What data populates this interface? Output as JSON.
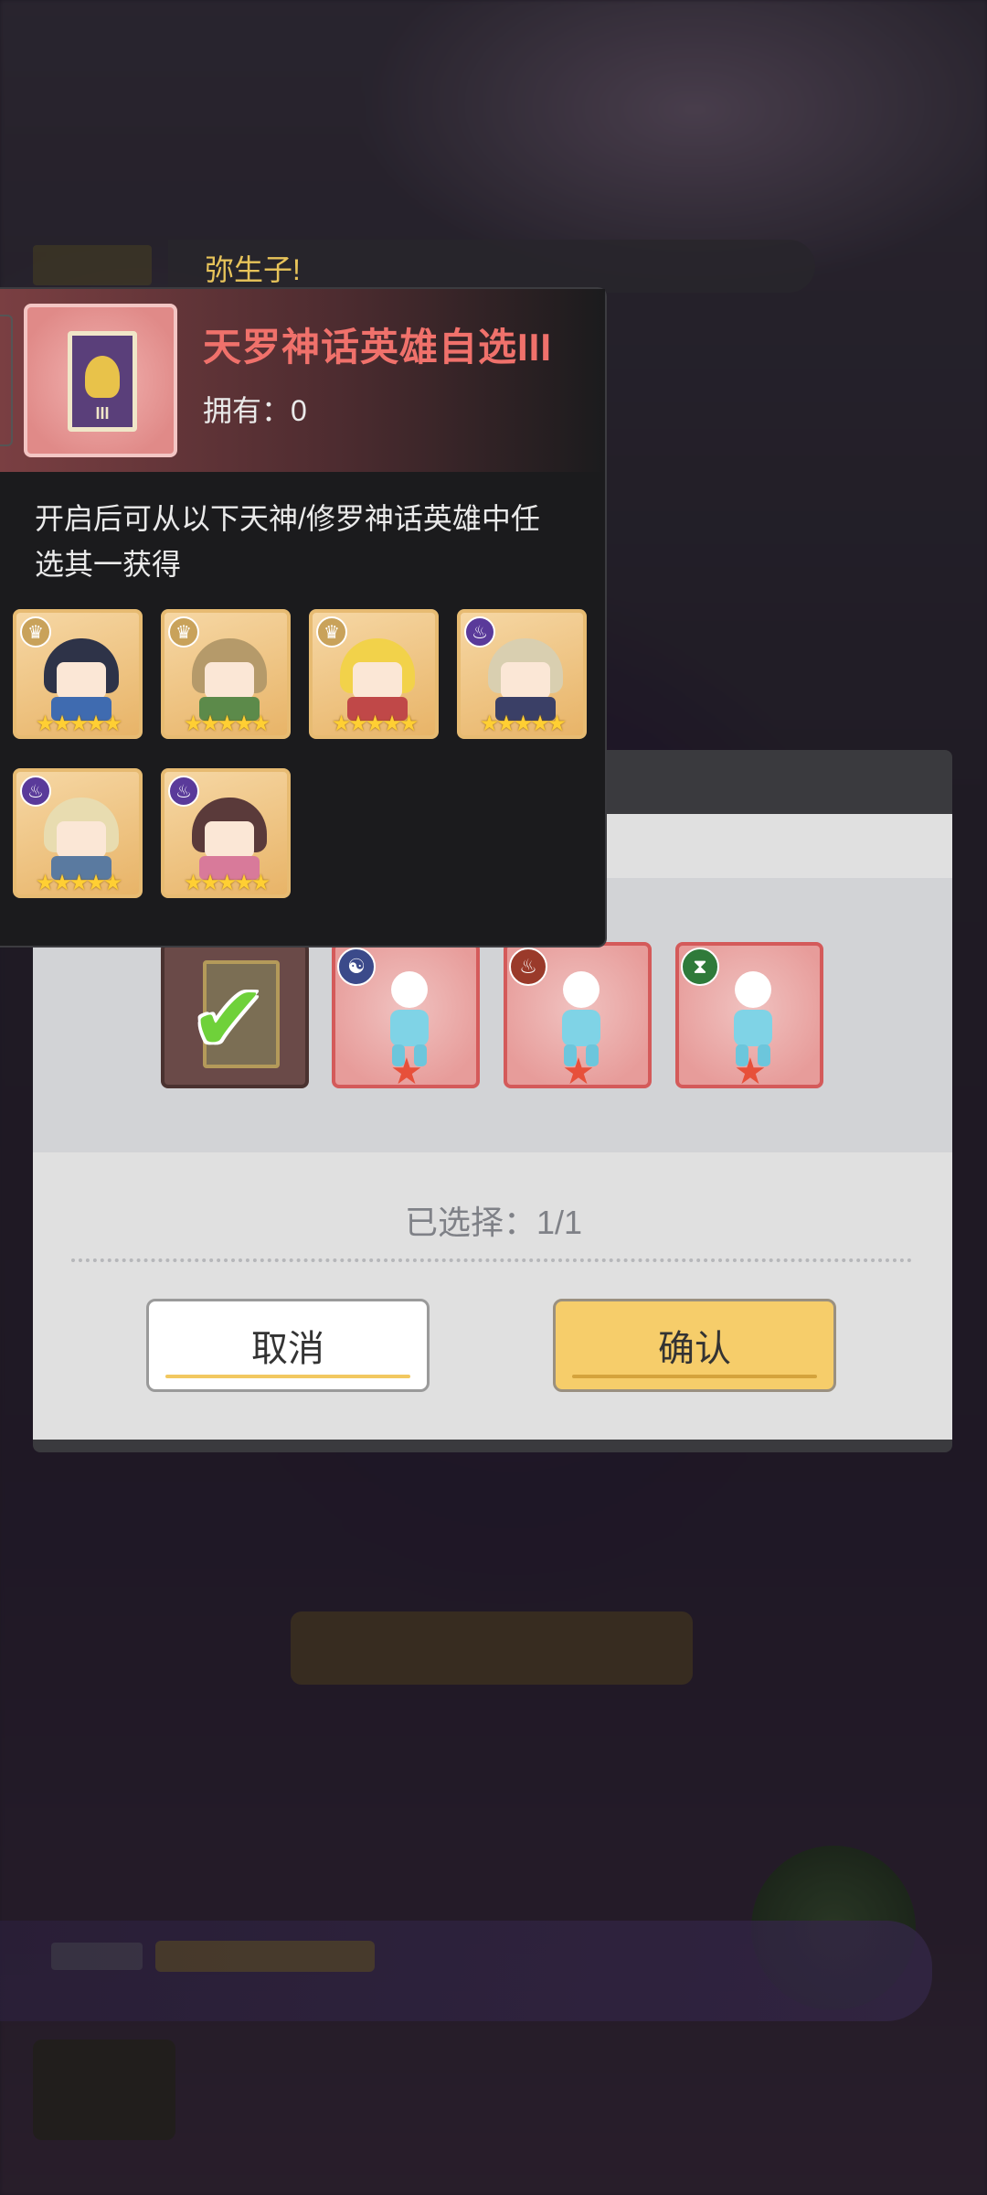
{
  "chat": {
    "speaker": "弥生子!"
  },
  "tooltip": {
    "title": "天罗神话英雄自选III",
    "owned": "拥有：0",
    "card_numeral": "III",
    "description": "开启后可从以下天神/修罗神话英雄中任选其一获得",
    "heroes": [
      {
        "name": "hero-1",
        "class": "crown-icon",
        "stars": "★★★★★"
      },
      {
        "name": "hero-2",
        "class": "crown-icon",
        "stars": "★★★★★"
      },
      {
        "name": "hero-3",
        "class": "crown-icon",
        "stars": "★★★★★"
      },
      {
        "name": "hero-4",
        "class": "flame-icon",
        "stars": "★★★★★"
      },
      {
        "name": "hero-5",
        "class": "flame-icon",
        "stars": "★★★★★"
      },
      {
        "name": "hero-6",
        "class": "flame-icon",
        "stars": "★★★★★"
      }
    ]
  },
  "dialog": {
    "slots": [
      {
        "type": "selected-card",
        "checked": true
      },
      {
        "type": "random-hero",
        "badge": "yin-yang-icon",
        "badge_color": "#3b4a8a"
      },
      {
        "type": "random-hero",
        "badge": "meditation-icon",
        "badge_color": "#9a3a2a"
      },
      {
        "type": "random-hero",
        "badge": "dna-icon",
        "badge_color": "#2f7a3a"
      }
    ],
    "selected": "已选择：1/1",
    "cancel_label": "取消",
    "confirm_label": "确认"
  },
  "colors": {
    "title": "#f0716b",
    "confirm": "#f6cd6a",
    "check": "#6fd13a"
  }
}
